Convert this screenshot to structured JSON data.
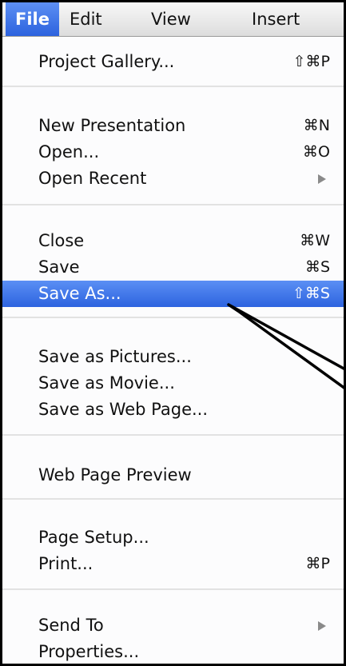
{
  "menubar": {
    "items": [
      "File",
      "Edit",
      "View",
      "Insert"
    ]
  },
  "menu": {
    "project_gallery": {
      "label": "Project Gallery...",
      "shortcut": "⇧⌘P"
    },
    "new_presentation": {
      "label": "New Presentation",
      "shortcut": "⌘N"
    },
    "open": {
      "label": "Open...",
      "shortcut": "⌘O"
    },
    "open_recent": {
      "label": "Open Recent"
    },
    "close": {
      "label": "Close",
      "shortcut": "⌘W"
    },
    "save": {
      "label": "Save",
      "shortcut": "⌘S"
    },
    "save_as": {
      "label": "Save As...",
      "shortcut": "⇧⌘S"
    },
    "save_as_pictures": {
      "label": "Save as Pictures..."
    },
    "save_as_movie": {
      "label": "Save as Movie..."
    },
    "save_as_web_page": {
      "label": "Save as Web Page..."
    },
    "web_page_preview": {
      "label": "Web Page Preview"
    },
    "page_setup": {
      "label": "Page Setup..."
    },
    "print": {
      "label": "Print...",
      "shortcut": "⌘P"
    },
    "send_to": {
      "label": "Send To"
    },
    "properties": {
      "label": "Properties..."
    }
  },
  "colors": {
    "highlight": "#3a6fe6",
    "callout_stroke": "#000000"
  }
}
